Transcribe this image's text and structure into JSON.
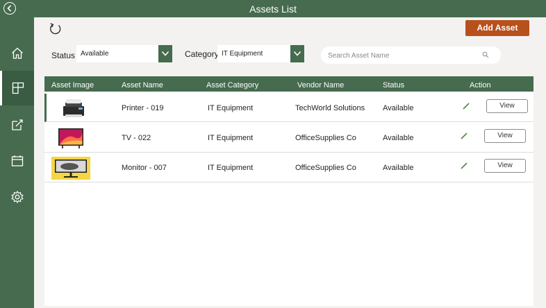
{
  "header": {
    "title": "Assets List"
  },
  "sidebar": {
    "items": [
      {
        "name": "home"
      },
      {
        "name": "assets",
        "active": true
      },
      {
        "name": "assign"
      },
      {
        "name": "calendar"
      },
      {
        "name": "settings"
      }
    ]
  },
  "toolbar": {
    "add_label": "Add Asset"
  },
  "filters": {
    "status_label": "Status",
    "status_value": "Available",
    "category_label": "Category",
    "category_value": "IT Equipment"
  },
  "search": {
    "placeholder": "Search Asset Name",
    "value": ""
  },
  "table": {
    "columns": [
      "Asset Image",
      "Asset Name",
      "Asset Category",
      "Vendor Name",
      "Status",
      "Action"
    ],
    "rows": [
      {
        "name": "Printer - 019",
        "category": "IT Equipment",
        "vendor": "TechWorld Solutions",
        "status": "Available",
        "action": "View"
      },
      {
        "name": "TV - 022",
        "category": "IT Equipment",
        "vendor": "OfficeSupplies Co",
        "status": "Available",
        "action": "View"
      },
      {
        "name": "Monitor - 007",
        "category": "IT Equipment",
        "vendor": "OfficeSupplies Co",
        "status": "Available",
        "action": "View"
      }
    ]
  },
  "colors": {
    "primary": "#466b4f",
    "accent": "#b8501c",
    "background": "#f3f2f1"
  }
}
